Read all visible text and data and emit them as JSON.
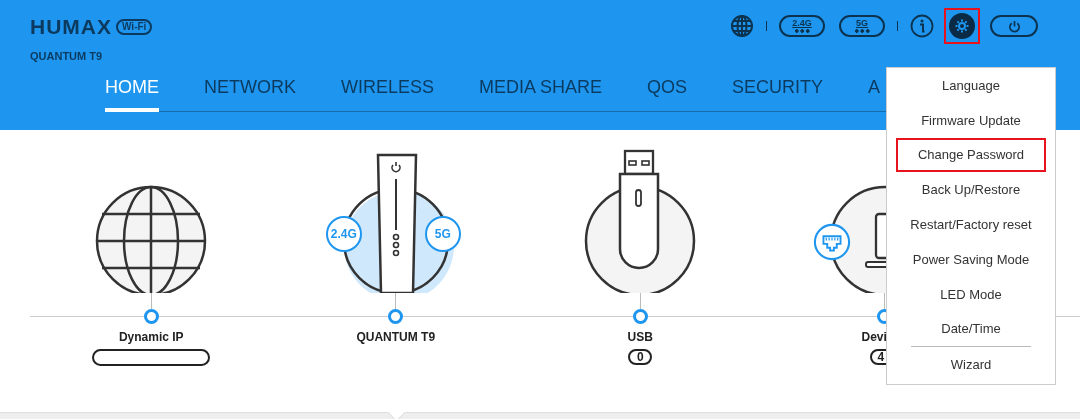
{
  "header": {
    "logo": "HUMAX",
    "logo_badge": "Wi-Fi",
    "model": "QUANTUM T9",
    "toolbar": [
      {
        "kind": "globe",
        "highlighted": false
      },
      {
        "kind": "divider"
      },
      {
        "kind": "band",
        "label": "2.4G",
        "highlighted": false
      },
      {
        "kind": "band",
        "label": "5G",
        "highlighted": false
      },
      {
        "kind": "divider"
      },
      {
        "kind": "info",
        "highlighted": false
      },
      {
        "kind": "settings",
        "highlighted": true
      },
      {
        "kind": "power",
        "highlighted": false
      }
    ]
  },
  "tabs": [
    {
      "label": "HOME",
      "selected": true
    },
    {
      "label": "NETWORK",
      "selected": false
    },
    {
      "label": "WIRELESS",
      "selected": false
    },
    {
      "label": "MEDIA SHARE",
      "selected": false
    },
    {
      "label": "QOS",
      "selected": false
    },
    {
      "label": "SECURITY",
      "selected": false
    },
    {
      "label": "A",
      "selected": false
    }
  ],
  "nodes": [
    {
      "kind": "internet",
      "label": "Dynamic IP",
      "value_hidden": true
    },
    {
      "kind": "router",
      "label": "QUANTUM T9",
      "badges": [
        "2.4G",
        "5G"
      ]
    },
    {
      "kind": "usb",
      "label": "USB",
      "value": "0"
    },
    {
      "kind": "devices",
      "label": "Devi",
      "value": "4"
    }
  ],
  "settings_menu": [
    {
      "label": "Language",
      "highlighted": false
    },
    {
      "label": "Firmware Update",
      "highlighted": false
    },
    {
      "label": "Change Password",
      "highlighted": true
    },
    {
      "label": "Back Up/Restore",
      "highlighted": false
    },
    {
      "label": "Restart/Factory reset",
      "highlighted": false
    },
    {
      "label": "Power Saving Mode",
      "highlighted": false
    },
    {
      "label": "LED Mode",
      "highlighted": false
    },
    {
      "label": "Date/Time",
      "highlighted": false
    },
    {
      "label": "Wizard",
      "highlighted": false,
      "divider_above": true
    }
  ]
}
